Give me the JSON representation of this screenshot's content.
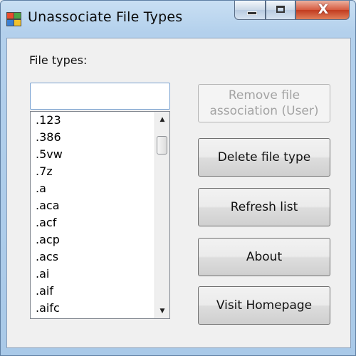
{
  "window": {
    "title": "Unassociate File Types",
    "icon": "app-icon",
    "caption": {
      "minimize_icon": "minimize-icon",
      "maximize_icon": "maximize-icon",
      "close_glyph": "X"
    }
  },
  "form": {
    "file_types_label": "File types:",
    "search_value": "",
    "search_placeholder": ""
  },
  "list": {
    "items": [
      ".123",
      ".386",
      ".5vw",
      ".7z",
      ".a",
      ".aca",
      ".acf",
      ".acp",
      ".acs",
      ".ai",
      ".aif",
      ".aifc"
    ]
  },
  "buttons": {
    "remove_file_association": "Remove file association (User)",
    "delete_file_type": "Delete file type",
    "refresh_list": "Refresh list",
    "about": "About",
    "visit_homepage": "Visit Homepage"
  },
  "colors": {
    "close_button": "#c23b1f",
    "title_bar": "#b3d0ec",
    "input_border": "#7aa2d1"
  }
}
